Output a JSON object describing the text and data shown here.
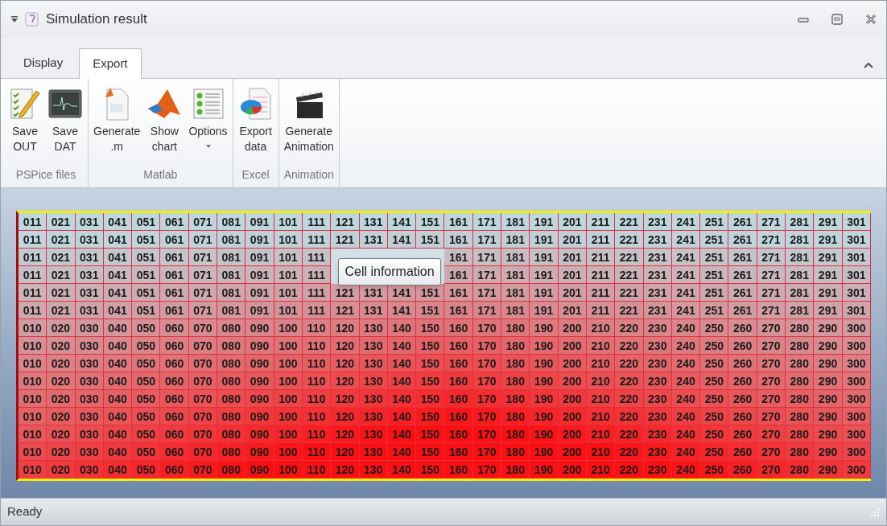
{
  "window": {
    "title": "Simulation result"
  },
  "tabs": [
    {
      "label": "Display",
      "selected": false
    },
    {
      "label": "Export",
      "selected": true
    }
  ],
  "ribbon": {
    "groups": [
      {
        "label": "PSPice files",
        "buttons": [
          {
            "lines": [
              "Save",
              "OUT"
            ]
          },
          {
            "lines": [
              "Save",
              "DAT"
            ]
          }
        ]
      },
      {
        "label": "Matlab",
        "buttons": [
          {
            "lines": [
              "Generate",
              ".m"
            ]
          },
          {
            "lines": [
              "Show",
              "chart"
            ]
          },
          {
            "lines": [
              "Options"
            ],
            "dropdown": true
          }
        ]
      },
      {
        "label": "Excel",
        "buttons": [
          {
            "lines": [
              "Export",
              "data"
            ]
          }
        ]
      },
      {
        "label": "Animation",
        "buttons": [
          {
            "lines": [
              "Generate",
              "Animation"
            ]
          }
        ]
      }
    ]
  },
  "grid": {
    "rows": [
      [
        "011",
        "021",
        "031",
        "041",
        "051",
        "061",
        "071",
        "081",
        "091",
        "101",
        "111",
        "121",
        "131",
        "141",
        "151",
        "161",
        "171",
        "181",
        "191",
        "201",
        "211",
        "221",
        "231",
        "241",
        "251",
        "261",
        "271",
        "281",
        "291",
        "301"
      ],
      [
        "011",
        "021",
        "031",
        "041",
        "051",
        "061",
        "071",
        "081",
        "091",
        "101",
        "111",
        "121",
        "131",
        "141",
        "151",
        "161",
        "171",
        "181",
        "191",
        "201",
        "211",
        "221",
        "231",
        "241",
        "251",
        "261",
        "271",
        "281",
        "291",
        "301"
      ],
      [
        "011",
        "021",
        "031",
        "041",
        "051",
        "061",
        "071",
        "081",
        "091",
        "101",
        "111",
        null,
        null,
        null,
        null,
        "161",
        "171",
        "181",
        "191",
        "201",
        "211",
        "221",
        "231",
        "241",
        "251",
        "261",
        "271",
        "281",
        "291",
        "301"
      ],
      [
        "011",
        "021",
        "031",
        "041",
        "051",
        "061",
        "071",
        "081",
        "091",
        "101",
        "111",
        null,
        null,
        null,
        null,
        "161",
        "171",
        "181",
        "191",
        "201",
        "211",
        "221",
        "231",
        "241",
        "251",
        "261",
        "271",
        "281",
        "291",
        "301"
      ],
      [
        "011",
        "021",
        "031",
        "041",
        "051",
        "061",
        "071",
        "081",
        "091",
        "101",
        "111",
        "121",
        "131",
        "141",
        "151",
        "161",
        "171",
        "181",
        "191",
        "201",
        "211",
        "221",
        "231",
        "241",
        "251",
        "261",
        "271",
        "281",
        "291",
        "301"
      ],
      [
        "011",
        "021",
        "031",
        "041",
        "051",
        "061",
        "071",
        "081",
        "091",
        "101",
        "111",
        "121",
        "131",
        "141",
        "151",
        "161",
        "171",
        "181",
        "191",
        "201",
        "211",
        "221",
        "231",
        "241",
        "251",
        "261",
        "271",
        "281",
        "291",
        "301"
      ],
      [
        "010",
        "020",
        "030",
        "040",
        "050",
        "060",
        "070",
        "080",
        "090",
        "100",
        "110",
        "120",
        "130",
        "140",
        "150",
        "160",
        "170",
        "180",
        "190",
        "200",
        "210",
        "220",
        "230",
        "240",
        "250",
        "260",
        "270",
        "280",
        "290",
        "300"
      ],
      [
        "010",
        "020",
        "030",
        "040",
        "050",
        "060",
        "070",
        "080",
        "090",
        "100",
        "110",
        "120",
        "130",
        "140",
        "150",
        "160",
        "170",
        "180",
        "190",
        "200",
        "210",
        "220",
        "230",
        "240",
        "250",
        "260",
        "270",
        "280",
        "290",
        "300"
      ],
      [
        "010",
        "020",
        "030",
        "040",
        "050",
        "060",
        "070",
        "080",
        "090",
        "100",
        "110",
        "120",
        "130",
        "140",
        "150",
        "160",
        "170",
        "180",
        "190",
        "200",
        "210",
        "220",
        "230",
        "240",
        "250",
        "260",
        "270",
        "280",
        "290",
        "300"
      ],
      [
        "010",
        "020",
        "030",
        "040",
        "050",
        "060",
        "070",
        "080",
        "090",
        "100",
        "110",
        "120",
        "130",
        "140",
        "150",
        "160",
        "170",
        "180",
        "190",
        "200",
        "210",
        "220",
        "230",
        "240",
        "250",
        "260",
        "270",
        "280",
        "290",
        "300"
      ],
      [
        "010",
        "020",
        "030",
        "040",
        "050",
        "060",
        "070",
        "080",
        "090",
        "100",
        "110",
        "120",
        "130",
        "140",
        "150",
        "160",
        "170",
        "180",
        "190",
        "200",
        "210",
        "220",
        "230",
        "240",
        "250",
        "260",
        "270",
        "280",
        "290",
        "300"
      ],
      [
        "010",
        "020",
        "030",
        "040",
        "050",
        "060",
        "070",
        "080",
        "090",
        "100",
        "110",
        "120",
        "130",
        "140",
        "150",
        "160",
        "170",
        "180",
        "190",
        "200",
        "210",
        "220",
        "230",
        "240",
        "250",
        "260",
        "270",
        "280",
        "290",
        "300"
      ],
      [
        "010",
        "020",
        "030",
        "040",
        "050",
        "060",
        "070",
        "080",
        "090",
        "100",
        "110",
        "120",
        "130",
        "140",
        "150",
        "160",
        "170",
        "180",
        "190",
        "200",
        "210",
        "220",
        "230",
        "240",
        "250",
        "260",
        "270",
        "280",
        "290",
        "300"
      ],
      [
        "010",
        "020",
        "030",
        "040",
        "050",
        "060",
        "070",
        "080",
        "090",
        "100",
        "110",
        "120",
        "130",
        "140",
        "150",
        "160",
        "170",
        "180",
        "190",
        "200",
        "210",
        "220",
        "230",
        "240",
        "250",
        "260",
        "270",
        "280",
        "290",
        "300"
      ],
      [
        "010",
        "020",
        "030",
        "040",
        "050",
        "060",
        "070",
        "080",
        "090",
        "100",
        "110",
        "120",
        "130",
        "140",
        "150",
        "160",
        "170",
        "180",
        "190",
        "200",
        "210",
        "220",
        "230",
        "240",
        "250",
        "260",
        "270",
        "280",
        "290",
        "300"
      ]
    ],
    "tooltip": "Cell information"
  },
  "status_bar": {
    "text": "Ready"
  }
}
